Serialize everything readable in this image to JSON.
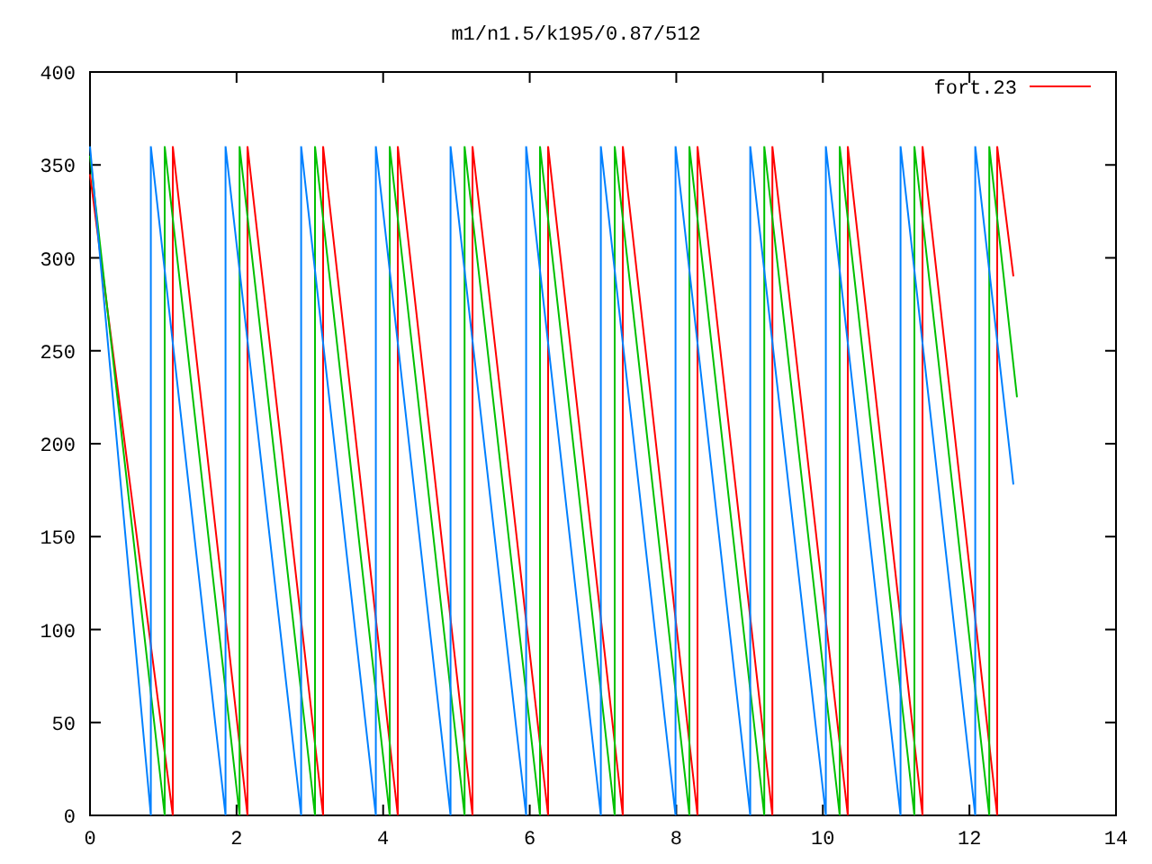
{
  "chart_data": {
    "type": "line",
    "title": "m1/n1.5/k195/0.87/512",
    "xlim": [
      0,
      14
    ],
    "ylim": [
      0,
      400
    ],
    "xticks": [
      0,
      2,
      4,
      6,
      8,
      10,
      12,
      14
    ],
    "yticks": [
      0,
      50,
      100,
      150,
      200,
      250,
      300,
      350,
      400
    ],
    "series": [
      {
        "name": "fort.23",
        "color": "#ff0000",
        "x": [
          0,
          1.13,
          1.13,
          2.15,
          2.15,
          3.18,
          3.18,
          4.2,
          4.2,
          5.22,
          5.22,
          6.25,
          6.25,
          7.27,
          7.27,
          8.29,
          8.29,
          9.31,
          9.31,
          10.34,
          10.34,
          11.36,
          11.36,
          12.38,
          12.38,
          12.6
        ],
        "values": [
          345,
          0,
          360,
          0,
          360,
          0,
          360,
          0,
          360,
          0,
          360,
          0,
          360,
          0,
          360,
          0,
          360,
          0,
          360,
          0,
          360,
          0,
          360,
          0,
          360,
          290
        ]
      },
      {
        "color": "#00c000",
        "x": [
          0,
          1.02,
          1.02,
          2.04,
          2.04,
          3.07,
          3.07,
          4.09,
          4.09,
          5.11,
          5.11,
          6.14,
          6.14,
          7.16,
          7.16,
          8.18,
          8.18,
          9.2,
          9.2,
          10.23,
          10.23,
          11.25,
          11.25,
          12.27,
          12.27,
          12.65
        ],
        "values": [
          355,
          0,
          360,
          0,
          360,
          0,
          360,
          0,
          360,
          0,
          360,
          0,
          360,
          0,
          360,
          0,
          360,
          0,
          360,
          0,
          360,
          0,
          360,
          0,
          360,
          225
        ]
      },
      {
        "color": "#0080ff",
        "x": [
          0,
          0.83,
          0.83,
          1.85,
          1.85,
          2.88,
          2.88,
          3.9,
          3.9,
          4.92,
          4.92,
          5.95,
          5.95,
          6.97,
          6.97,
          7.99,
          7.99,
          9.01,
          9.01,
          10.04,
          10.04,
          11.06,
          11.06,
          12.08,
          12.08,
          12.6
        ],
        "values": [
          360,
          0,
          360,
          0,
          360,
          0,
          360,
          0,
          360,
          0,
          360,
          0,
          360,
          0,
          360,
          0,
          360,
          0,
          360,
          0,
          360,
          0,
          360,
          0,
          360,
          178
        ]
      }
    ]
  }
}
